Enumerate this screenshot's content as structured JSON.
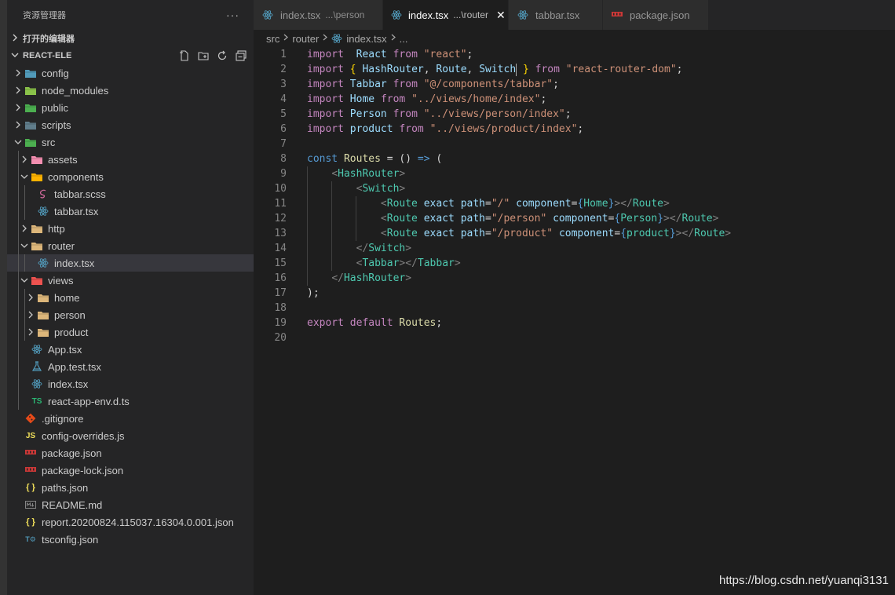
{
  "explorer": {
    "title": "资源管理器",
    "more": "···",
    "open_editors_label": "打开的编辑器",
    "project_label": "REACT-ELE"
  },
  "tree": [
    {
      "label": "config",
      "depth": 0,
      "type": "folder",
      "chevron": "right",
      "icon": "config-folder-icon",
      "color": "#519aba"
    },
    {
      "label": "node_modules",
      "depth": 0,
      "type": "folder",
      "chevron": "right",
      "icon": "node-folder-icon",
      "color": "#8bc34a"
    },
    {
      "label": "public",
      "depth": 0,
      "type": "folder",
      "chevron": "right",
      "icon": "public-folder-icon",
      "color": "#4caf50"
    },
    {
      "label": "scripts",
      "depth": 0,
      "type": "folder",
      "chevron": "right",
      "icon": "scripts-folder-icon",
      "color": "#607d8b"
    },
    {
      "label": "src",
      "depth": 0,
      "type": "folder",
      "chevron": "down",
      "icon": "src-folder-icon",
      "color": "#4caf50"
    },
    {
      "label": "assets",
      "depth": 1,
      "type": "folder",
      "chevron": "right",
      "icon": "assets-folder-icon",
      "color": "#f48fb1"
    },
    {
      "label": "components",
      "depth": 1,
      "type": "folder",
      "chevron": "down",
      "icon": "components-folder-icon",
      "color": "#ffb300"
    },
    {
      "label": "tabbar.scss",
      "depth": 2,
      "type": "file",
      "icon": "sass-icon",
      "color": "#cd6799"
    },
    {
      "label": "tabbar.tsx",
      "depth": 2,
      "type": "file",
      "icon": "react-icon",
      "color": "#519aba"
    },
    {
      "label": "http",
      "depth": 1,
      "type": "folder",
      "chevron": "right",
      "icon": "folder-icon",
      "color": "#dcb67a"
    },
    {
      "label": "router",
      "depth": 1,
      "type": "folder",
      "chevron": "down",
      "icon": "router-folder-icon",
      "color": "#dcb67a"
    },
    {
      "label": "index.tsx",
      "depth": 2,
      "type": "file",
      "icon": "react-icon",
      "color": "#519aba",
      "active": true
    },
    {
      "label": "views",
      "depth": 1,
      "type": "folder",
      "chevron": "down",
      "icon": "views-folder-icon",
      "color": "#ef5350"
    },
    {
      "label": "home",
      "depth": 2,
      "type": "folder",
      "chevron": "right",
      "icon": "folder-icon",
      "color": "#dcb67a"
    },
    {
      "label": "person",
      "depth": 2,
      "type": "folder",
      "chevron": "right",
      "icon": "folder-icon",
      "color": "#dcb67a"
    },
    {
      "label": "product",
      "depth": 2,
      "type": "folder",
      "chevron": "right",
      "icon": "folder-icon",
      "color": "#dcb67a"
    },
    {
      "label": "App.tsx",
      "depth": 1,
      "type": "file",
      "icon": "react-icon",
      "color": "#519aba"
    },
    {
      "label": "App.test.tsx",
      "depth": 1,
      "type": "file",
      "icon": "test-icon",
      "color": "#519aba"
    },
    {
      "label": "index.tsx",
      "depth": 1,
      "type": "file",
      "icon": "react-icon",
      "color": "#519aba"
    },
    {
      "label": "react-app-env.d.ts",
      "depth": 1,
      "type": "file",
      "icon": "typescript-icon",
      "color": "#2bb673"
    },
    {
      "label": ".gitignore",
      "depth": 0,
      "type": "file",
      "icon": "git-icon",
      "color": "#e64a19"
    },
    {
      "label": "config-overrides.js",
      "depth": 0,
      "type": "file",
      "icon": "javascript-icon",
      "color": "#f1e05a"
    },
    {
      "label": "package.json",
      "depth": 0,
      "type": "file",
      "icon": "npm-icon",
      "color": "#cb3837"
    },
    {
      "label": "package-lock.json",
      "depth": 0,
      "type": "file",
      "icon": "npm-icon",
      "color": "#cb3837"
    },
    {
      "label": "paths.json",
      "depth": 0,
      "type": "file",
      "icon": "json-icon",
      "color": "#f1e05a"
    },
    {
      "label": "README.md",
      "depth": 0,
      "type": "file",
      "icon": "markdown-icon",
      "color": "#858585"
    },
    {
      "label": "report.20200824.115037.16304.0.001.json",
      "depth": 0,
      "type": "file",
      "icon": "json-icon",
      "color": "#f1e05a"
    },
    {
      "label": "tsconfig.json",
      "depth": 0,
      "type": "file",
      "icon": "tsconfig-icon",
      "color": "#519aba"
    }
  ],
  "tabs": [
    {
      "label": "index.tsx",
      "desc": "...\\person",
      "icon": "react-icon",
      "active": false,
      "width": 165
    },
    {
      "label": "index.tsx",
      "desc": "...\\router",
      "icon": "react-icon",
      "active": true,
      "width": 160
    },
    {
      "label": "tabbar.tsx",
      "desc": "",
      "icon": "react-icon",
      "active": false,
      "width": 120
    },
    {
      "label": "package.json",
      "desc": "",
      "icon": "npm-icon",
      "active": false,
      "width": 135
    }
  ],
  "breadcrumb": [
    "src",
    "router",
    "index.tsx",
    "..."
  ],
  "code_lines": [
    [
      [
        "k",
        "import"
      ],
      [
        "",
        "  "
      ],
      [
        "v",
        "React"
      ],
      [
        "",
        " "
      ],
      [
        "k",
        "from"
      ],
      [
        "",
        " "
      ],
      [
        "s",
        "\"react\""
      ],
      [
        "",
        ";"
      ]
    ],
    [
      [
        "k",
        "import"
      ],
      [
        "",
        " "
      ],
      [
        "y",
        "{"
      ],
      [
        "",
        " "
      ],
      [
        "v",
        "HashRouter"
      ],
      [
        "",
        ", "
      ],
      [
        "v",
        "Route"
      ],
      [
        "",
        ", "
      ],
      [
        "v",
        "Switch"
      ],
      [
        "",
        " "
      ],
      [
        "y",
        "}"
      ],
      [
        "",
        " "
      ],
      [
        "k",
        "from"
      ],
      [
        "",
        " "
      ],
      [
        "s",
        "\"react-router-dom\""
      ],
      [
        "",
        ";"
      ]
    ],
    [
      [
        "k",
        "import"
      ],
      [
        "",
        " "
      ],
      [
        "v",
        "Tabbar"
      ],
      [
        "",
        " "
      ],
      [
        "k",
        "from"
      ],
      [
        "",
        " "
      ],
      [
        "s",
        "\"@/components/tabbar\""
      ],
      [
        "",
        ";"
      ]
    ],
    [
      [
        "k",
        "import"
      ],
      [
        "",
        " "
      ],
      [
        "v",
        "Home"
      ],
      [
        "",
        " "
      ],
      [
        "k",
        "from"
      ],
      [
        "",
        " "
      ],
      [
        "s",
        "\"../views/home/index\""
      ],
      [
        "",
        ";"
      ]
    ],
    [
      [
        "k",
        "import"
      ],
      [
        "",
        " "
      ],
      [
        "v",
        "Person"
      ],
      [
        "",
        " "
      ],
      [
        "k",
        "from"
      ],
      [
        "",
        " "
      ],
      [
        "s",
        "\"../views/person/index\""
      ],
      [
        "",
        ";"
      ]
    ],
    [
      [
        "k",
        "import"
      ],
      [
        "",
        " "
      ],
      [
        "v",
        "product"
      ],
      [
        "",
        " "
      ],
      [
        "k",
        "from"
      ],
      [
        "",
        " "
      ],
      [
        "s",
        "\"../views/product/index\""
      ],
      [
        "",
        ";"
      ]
    ],
    [],
    [
      [
        "b",
        "const"
      ],
      [
        "",
        " "
      ],
      [
        "f",
        "Routes"
      ],
      [
        "",
        " = () "
      ],
      [
        "b",
        "=>"
      ],
      [
        "",
        " ("
      ]
    ],
    [
      [
        "",
        "    "
      ],
      [
        "p",
        "<"
      ],
      [
        "tg",
        "HashRouter"
      ],
      [
        "p",
        ">"
      ]
    ],
    [
      [
        "",
        "        "
      ],
      [
        "p",
        "<"
      ],
      [
        "tg",
        "Switch"
      ],
      [
        "p",
        ">"
      ]
    ],
    [
      [
        "",
        "            "
      ],
      [
        "p",
        "<"
      ],
      [
        "tg",
        "Route"
      ],
      [
        "",
        " "
      ],
      [
        "v",
        "exact"
      ],
      [
        "",
        " "
      ],
      [
        "v",
        "path"
      ],
      [
        "",
        "="
      ],
      [
        "s",
        "\"/\""
      ],
      [
        "",
        " "
      ],
      [
        "v",
        "component"
      ],
      [
        "",
        "="
      ],
      [
        "b",
        "{"
      ],
      [
        "tg",
        "Home"
      ],
      [
        "b",
        "}"
      ],
      [
        "p",
        "></"
      ],
      [
        "tg",
        "Route"
      ],
      [
        "p",
        ">"
      ]
    ],
    [
      [
        "",
        "            "
      ],
      [
        "p",
        "<"
      ],
      [
        "tg",
        "Route"
      ],
      [
        "",
        " "
      ],
      [
        "v",
        "exact"
      ],
      [
        "",
        " "
      ],
      [
        "v",
        "path"
      ],
      [
        "",
        "="
      ],
      [
        "s",
        "\"/person\""
      ],
      [
        "",
        " "
      ],
      [
        "v",
        "component"
      ],
      [
        "",
        "="
      ],
      [
        "b",
        "{"
      ],
      [
        "tg",
        "Person"
      ],
      [
        "b",
        "}"
      ],
      [
        "p",
        "></"
      ],
      [
        "tg",
        "Route"
      ],
      [
        "p",
        ">"
      ]
    ],
    [
      [
        "",
        "            "
      ],
      [
        "p",
        "<"
      ],
      [
        "tg",
        "Route"
      ],
      [
        "",
        " "
      ],
      [
        "v",
        "exact"
      ],
      [
        "",
        " "
      ],
      [
        "v",
        "path"
      ],
      [
        "",
        "="
      ],
      [
        "s",
        "\"/product\""
      ],
      [
        "",
        " "
      ],
      [
        "v",
        "component"
      ],
      [
        "",
        "="
      ],
      [
        "b",
        "{"
      ],
      [
        "tg",
        "product"
      ],
      [
        "b",
        "}"
      ],
      [
        "p",
        "></"
      ],
      [
        "tg",
        "Route"
      ],
      [
        "p",
        ">"
      ]
    ],
    [
      [
        "",
        "        "
      ],
      [
        "p",
        "</"
      ],
      [
        "tg",
        "Switch"
      ],
      [
        "p",
        ">"
      ]
    ],
    [
      [
        "",
        "        "
      ],
      [
        "p",
        "<"
      ],
      [
        "tg",
        "Tabbar"
      ],
      [
        "p",
        "></"
      ],
      [
        "tg",
        "Tabbar"
      ],
      [
        "p",
        ">"
      ]
    ],
    [
      [
        "",
        "    "
      ],
      [
        "p",
        "</"
      ],
      [
        "tg",
        "HashRouter"
      ],
      [
        "p",
        ">"
      ]
    ],
    [
      [
        "",
        ");"
      ]
    ],
    [],
    [
      [
        "k",
        "export"
      ],
      [
        "",
        " "
      ],
      [
        "k",
        "default"
      ],
      [
        "",
        " "
      ],
      [
        "f",
        "Routes"
      ],
      [
        "",
        ";"
      ]
    ],
    []
  ],
  "watermark": "https://blog.csdn.net/yuanqi3131"
}
